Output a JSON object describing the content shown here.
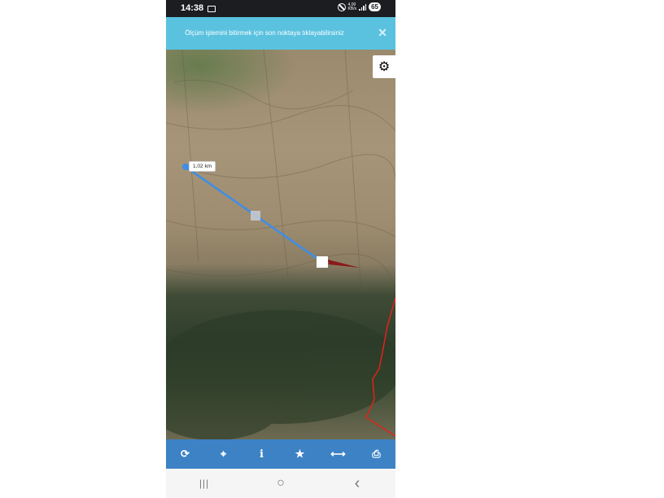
{
  "status_bar": {
    "time": "14:38",
    "network": "4,00",
    "network_unit": "KB/s",
    "battery": "65",
    "icons": [
      "notification-icon",
      "do-not-disturb-icon",
      "signal-icon"
    ]
  },
  "banner": {
    "text": "Ölçüm işlemini bitirmek için son noktaya tıklayabilirsiniz",
    "close_label": "✕"
  },
  "map": {
    "distance_label": "1,02 km",
    "measure_line_color": "#3d8ee8",
    "boundary_color": "#e0241b",
    "marker_color": "#8b1a1a"
  },
  "toolbar": {
    "items": [
      {
        "name": "refresh",
        "icon": "refresh-icon",
        "glyph": "⟳"
      },
      {
        "name": "locate",
        "icon": "crosshair-icon",
        "glyph": "⌖"
      },
      {
        "name": "info",
        "icon": "info-icon",
        "glyph": "i"
      },
      {
        "name": "favorite",
        "icon": "star-icon",
        "glyph": "★"
      },
      {
        "name": "measure",
        "icon": "measure-icon",
        "glyph": "⟷"
      },
      {
        "name": "print",
        "icon": "print-icon",
        "glyph": "⎙"
      }
    ],
    "background": "#3c82c5"
  },
  "nav_bar": {
    "recent_glyph": "|||",
    "home_glyph": "○",
    "back_glyph": "‹"
  }
}
